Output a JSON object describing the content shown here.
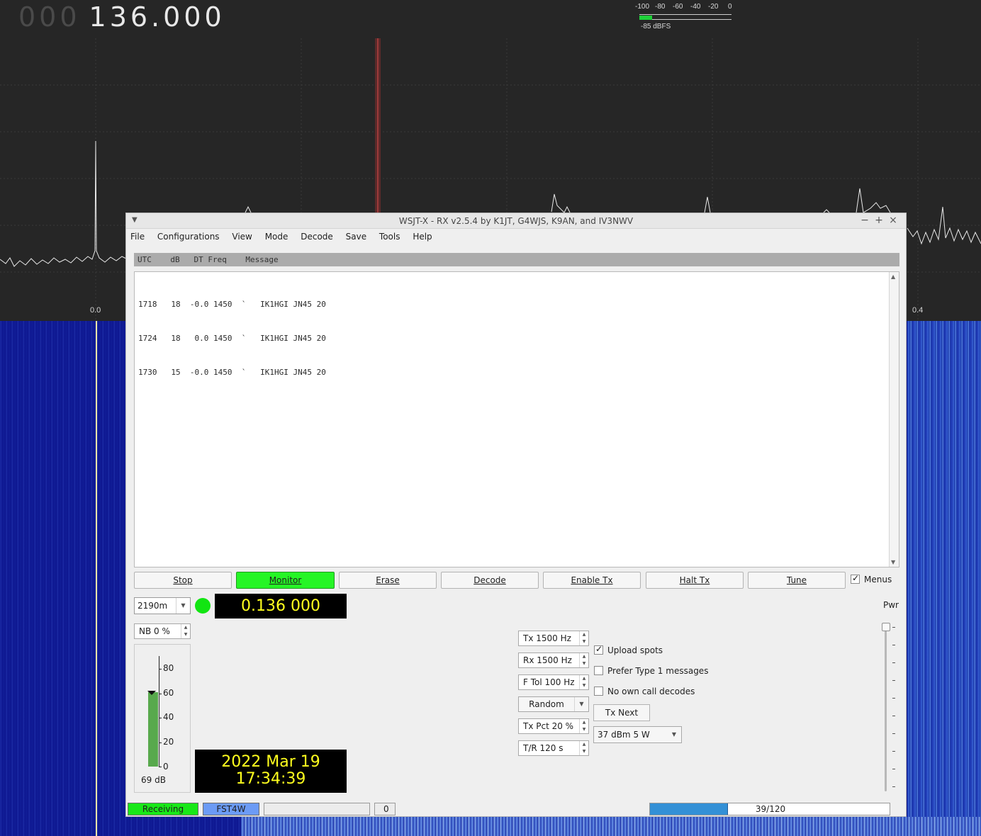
{
  "sdr": {
    "freq_dim": "000",
    "freq_main": "136.000",
    "smeter_ticks": [
      "-100",
      "-80",
      "-60",
      "-40",
      "-20",
      "0"
    ],
    "smeter_level_fraction": 0.14,
    "smeter_dbfs": "-85 dBFS",
    "axis_left": "0.0",
    "axis_right": "0.4"
  },
  "window": {
    "title": "WSJT-X - RX   v2.5.4   by K1JT, G4WJS, K9AN, and IV3NWV",
    "controls": {
      "minimize": "−",
      "maximize": "+",
      "close": "×"
    }
  },
  "menu": [
    "File",
    "Configurations",
    "View",
    "Mode",
    "Decode",
    "Save",
    "Tools",
    "Help"
  ],
  "decodes": {
    "header": "UTC    dB   DT Freq    Message",
    "lines": [
      "1718   18  -0.0 1450  `   IK1HGI JN45 20",
      "1724   18   0.0 1450  `   IK1HGI JN45 20",
      "1730   15  -0.0 1450  `   IK1HGI JN45 20"
    ]
  },
  "buttons": {
    "stop": "Stop",
    "monitor": "Monitor",
    "erase": "Erase",
    "decode": "Decode",
    "enable_tx": "Enable Tx",
    "halt_tx": "Halt Tx",
    "tune": "Tune",
    "tx_next": "Tx Next"
  },
  "menus_checkbox": {
    "label": "Menus",
    "checked": true
  },
  "band": {
    "value": "2190m"
  },
  "dial_frequency": "0.136 000",
  "pwr_label": "Pwr",
  "nb": "NB  0  %",
  "signal_meter": {
    "ticks": [
      "80",
      "60",
      "40",
      "20",
      "0"
    ],
    "level_db": 69,
    "label": "69 dB"
  },
  "datetime": {
    "date": "2022 Mar 19",
    "time": "17:34:39"
  },
  "tx_controls": {
    "tx": "Tx  1500  Hz",
    "rx": "Rx  1500  Hz",
    "ftol": "F Tol  100  Hz",
    "random": "Random",
    "txpct": "Tx Pct 20  %",
    "tr": "T/R  120  s",
    "power": "37 dBm  5 W"
  },
  "options": {
    "upload_spots": {
      "label": "Upload spots",
      "checked": true
    },
    "prefer_type1": {
      "label": "Prefer Type 1 messages",
      "checked": false
    },
    "no_own_call": {
      "label": "No own call decodes",
      "checked": false
    }
  },
  "status": {
    "receiving": "Receiving",
    "mode": "FST4W",
    "count": "0",
    "progress_label": "39/120",
    "progress_fraction": 0.325
  },
  "colors": {
    "monitor_active": "#26f526",
    "receiving": "#18e818",
    "mode_badge": "#6c9bf5",
    "lcd_text": "#ffff1e",
    "waterfall": "#0d1690"
  }
}
